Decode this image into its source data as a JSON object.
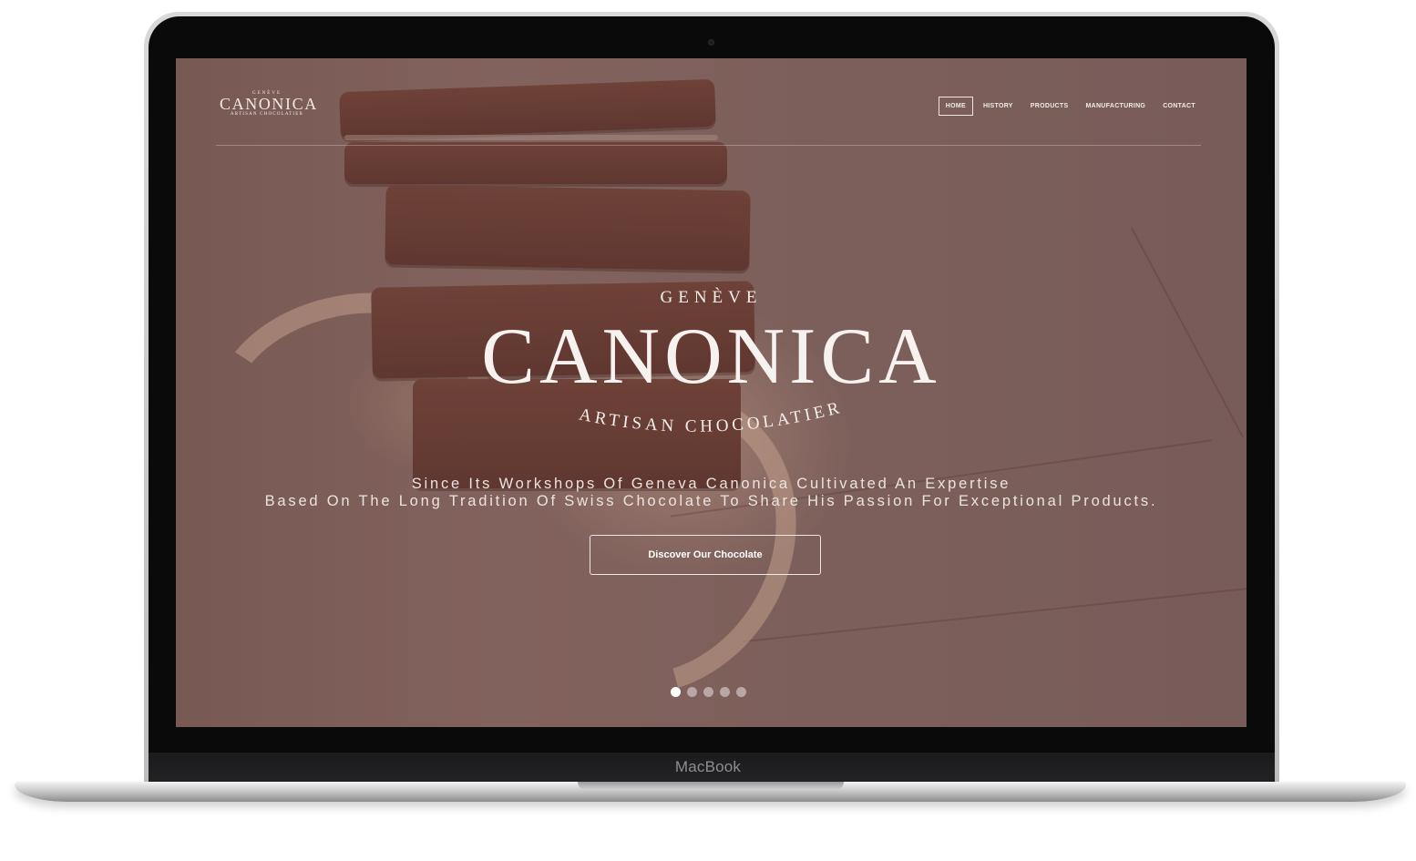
{
  "device": {
    "label": "MacBook"
  },
  "site": {
    "logo": {
      "top": "GENÈVE",
      "name": "CANONICA",
      "sub": "ARTISAN CHOCOLATIER"
    },
    "nav": [
      {
        "label": "HOME",
        "active": true
      },
      {
        "label": "HISTORY",
        "active": false
      },
      {
        "label": "PRODUCTS",
        "active": false
      },
      {
        "label": "MANUFACTURING",
        "active": false
      },
      {
        "label": "CONTACT",
        "active": false
      }
    ],
    "hero": {
      "top": "GENÈVE",
      "name": "CANONICA",
      "arc": "ARTISAN CHOCOLATIER",
      "tagline_1": "Since Its Workshops Of Geneva Canonica Cultivated An Expertise",
      "tagline_2": "Based On The Long Tradition Of Swiss Chocolate To Share His Passion For Exceptional Products.",
      "cta": "Discover Our Chocolate"
    },
    "slider": {
      "count": 5,
      "active_index": 0
    }
  },
  "colors": {
    "overlay": "#6e504e",
    "text": "#f4eeeb"
  }
}
